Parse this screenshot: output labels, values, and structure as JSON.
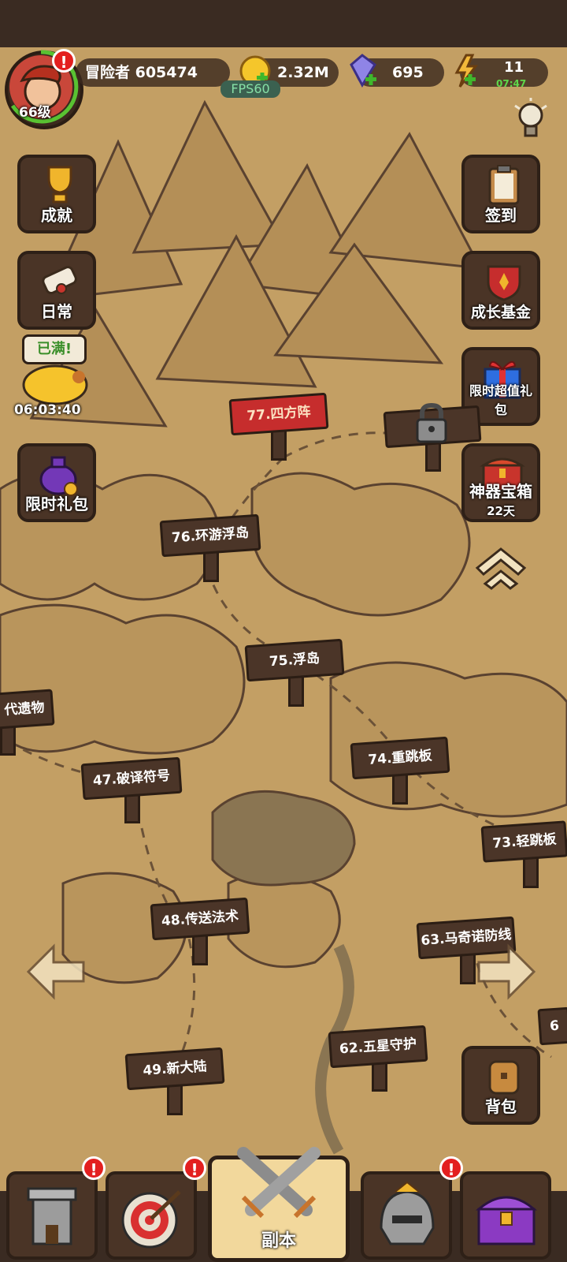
{
  "top": {
    "player_name": "冒险者 605474",
    "level": "66级",
    "gold": "2.32M",
    "fps": "FPS60",
    "gems": "695",
    "energy": "11",
    "energy_timer": "07:47"
  },
  "left_buttons": {
    "achievement": "成就",
    "daily": "日常",
    "piggy_bubble": "已满!",
    "piggy_timer": "06:03:40",
    "limited_gift": "限时礼包"
  },
  "right_buttons": {
    "signin": "签到",
    "growth_fund": "成长基金",
    "value_pack": "限时超值礼包",
    "artifact_chest": "神器宝箱",
    "artifact_days": "22天",
    "backpack": "背包"
  },
  "levels": {
    "l77": "77.四方阵",
    "l76": "76.环游浮岛",
    "l75": "75.浮岛",
    "l74": "74.重跳板",
    "l73": "73.轻跳板",
    "l47": "47.破译符号",
    "l48": "48.传送法术",
    "l49": "49.新大陆",
    "l62": "62.五星守护",
    "l63": "63.马奇诺防线",
    "left_partial": "代遗物",
    "right_partial": "6"
  },
  "bottom": {
    "dungeon": "副本"
  },
  "badges": {
    "alert": "!"
  },
  "colors": {
    "map": "#c39f64",
    "sign": "#4b3528",
    "active_tab": "#f2d89c",
    "badge": "#e31f1f"
  }
}
